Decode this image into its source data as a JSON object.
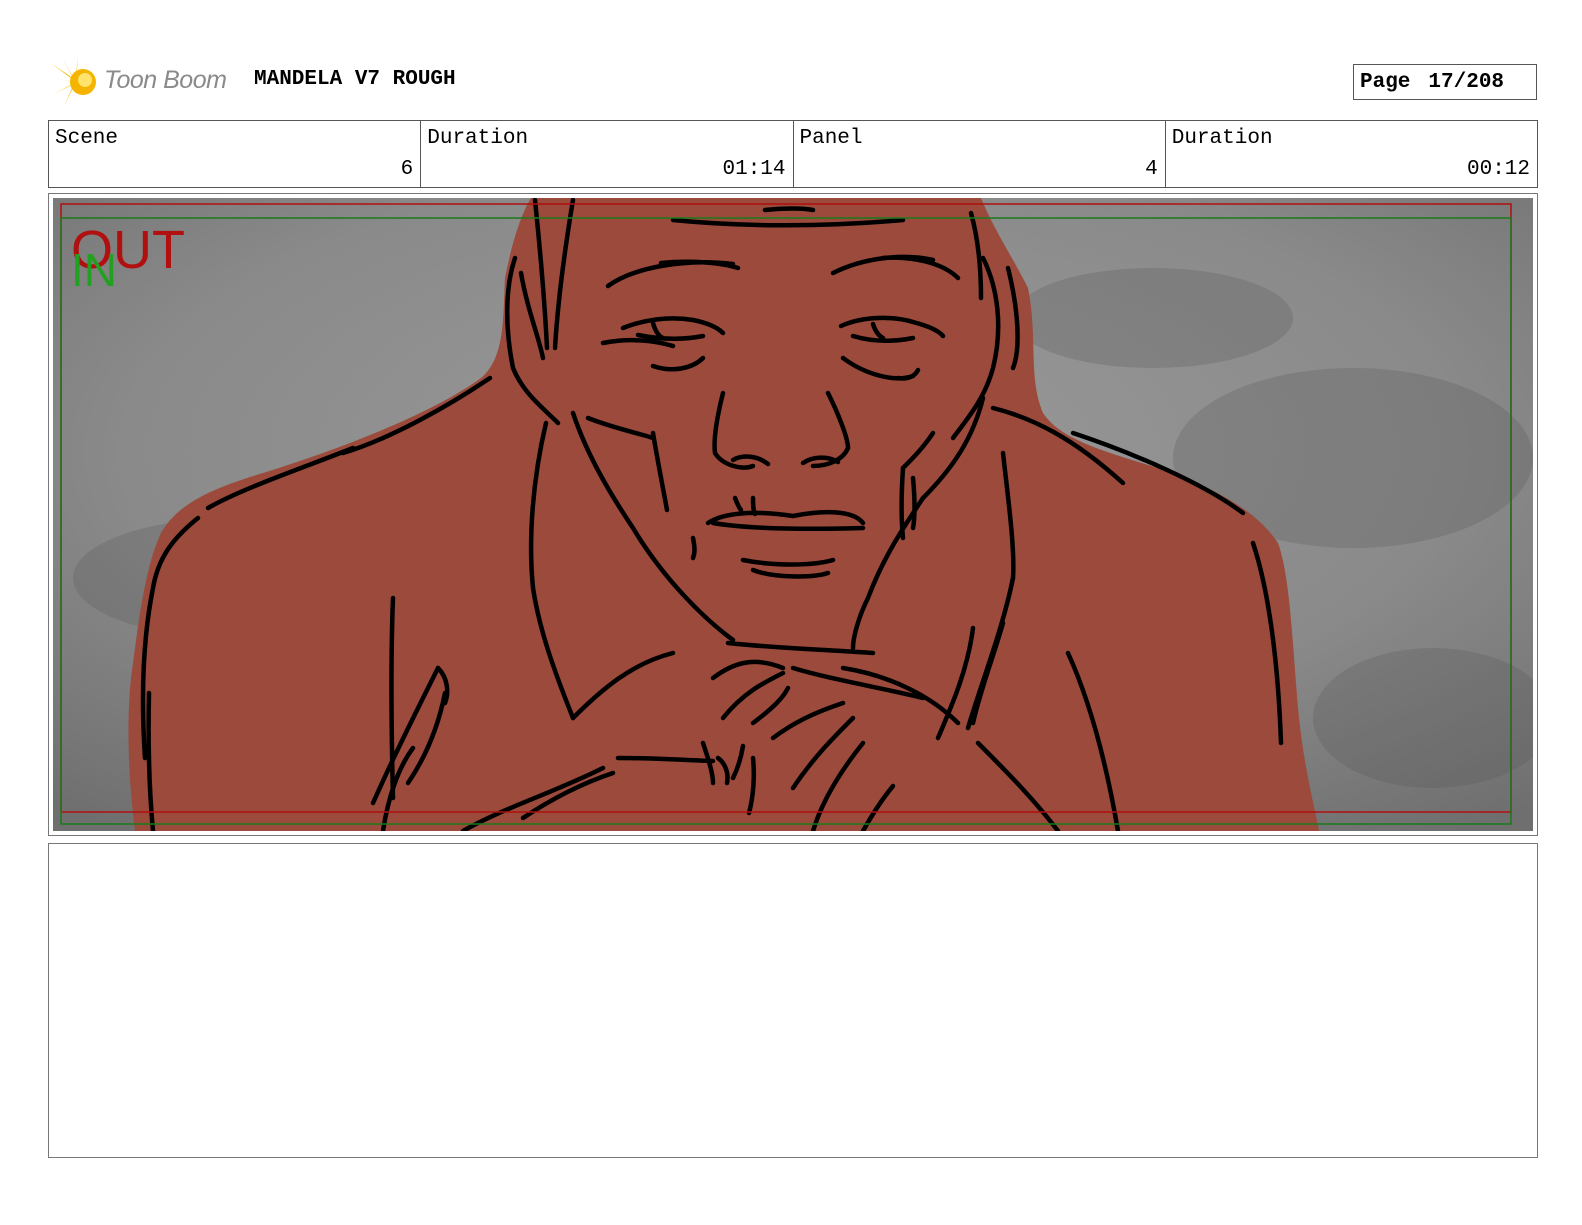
{
  "header": {
    "logo_text": "Toon Boom",
    "title": "MANDELA V7 ROUGH",
    "page_label": "Page",
    "page_number": "17/208"
  },
  "info": [
    {
      "label": "Scene",
      "value": "6"
    },
    {
      "label": "Duration",
      "value": "01:14"
    },
    {
      "label": "Panel",
      "value": "4"
    },
    {
      "label": "Duration",
      "value": "00:12"
    }
  ],
  "panel": {
    "out_marker": "OUT",
    "in_marker": "IN",
    "colors": {
      "figure_fill": "#9b4a3b",
      "background": "#8c8c8c",
      "out_frame": "#b01010",
      "in_frame": "#1a8a1a",
      "ink": "#000000"
    }
  },
  "notes": {
    "text": ""
  }
}
